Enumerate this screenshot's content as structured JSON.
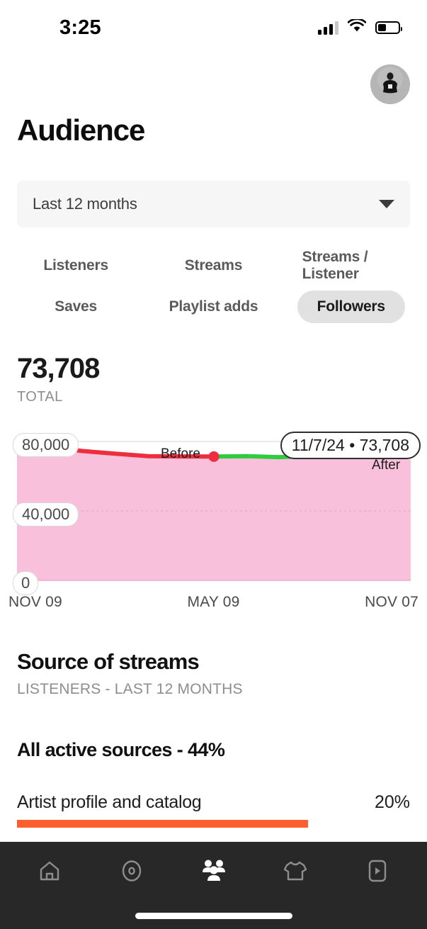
{
  "status_bar": {
    "time": "3:25",
    "signal_icon": "cellular-bars-icon",
    "wifi_icon": "wifi-icon",
    "battery_icon": "battery-icon",
    "battery_level_pct": 42
  },
  "header": {
    "title": "Audience",
    "avatar_name": "profile-avatar"
  },
  "range_select": {
    "value": "Last 12 months",
    "caret_icon": "chevron-down-icon"
  },
  "metric_chips": [
    {
      "label": "Listeners",
      "selected": false
    },
    {
      "label": "Streams",
      "selected": false
    },
    {
      "label": "Streams / Listener",
      "selected": false
    },
    {
      "label": "Saves",
      "selected": false
    },
    {
      "label": "Playlist adds",
      "selected": false
    },
    {
      "label": "Followers",
      "selected": true
    }
  ],
  "summary": {
    "value": "73,708",
    "label": "TOTAL"
  },
  "chart_data": {
    "type": "area",
    "title": "",
    "xlabel": "",
    "ylabel": "",
    "ylim": [
      0,
      80000
    ],
    "y_ticks": [
      "0",
      "40,000",
      "80,000"
    ],
    "x_ticks": [
      "NOV 09",
      "MAY 09",
      "NOV 07"
    ],
    "grid": true,
    "legend": "none",
    "fill_color": "#f9c0dc",
    "tooltip": "11/7/24 • 73,708",
    "annotations": [
      {
        "text": "Before",
        "series": "before"
      },
      {
        "text": "After",
        "series": "after"
      }
    ],
    "series": [
      {
        "name": "Before",
        "color": "#ec2e3e",
        "x": [
          "NOV 09",
          "DEC 09",
          "JAN 09",
          "FEB 09",
          "MAR 09",
          "APR 09",
          "MAY 09"
        ],
        "values": [
          77000,
          76800,
          74500,
          73000,
          71500,
          71400,
          71300
        ]
      },
      {
        "name": "After",
        "color": "#2fcc3e",
        "x": [
          "MAY 09",
          "JUN 09",
          "JUL 09",
          "AUG 09",
          "SEP 09",
          "OCT 09",
          "NOV 07"
        ],
        "values": [
          71300,
          71500,
          71000,
          71800,
          72300,
          73100,
          73708
        ]
      }
    ],
    "end_marker_color": "#f2549a"
  },
  "sources": {
    "title": "Source of streams",
    "subtitle": "LISTENERS - LAST 12 MONTHS",
    "all_active": "All active sources - 44%",
    "rows": [
      {
        "name": "Artist profile and catalog",
        "pct": "20%",
        "bar_pct": 74,
        "bar_color": "#fb5f2d"
      }
    ]
  },
  "bottom_nav": {
    "items": [
      {
        "name": "home",
        "icon": "home-icon",
        "active": false
      },
      {
        "name": "music",
        "icon": "disc-icon",
        "active": false
      },
      {
        "name": "audience",
        "icon": "audience-people-icon",
        "active": true
      },
      {
        "name": "merch",
        "icon": "tshirt-icon",
        "active": false
      },
      {
        "name": "videos",
        "icon": "video-play-icon",
        "active": false
      }
    ]
  }
}
